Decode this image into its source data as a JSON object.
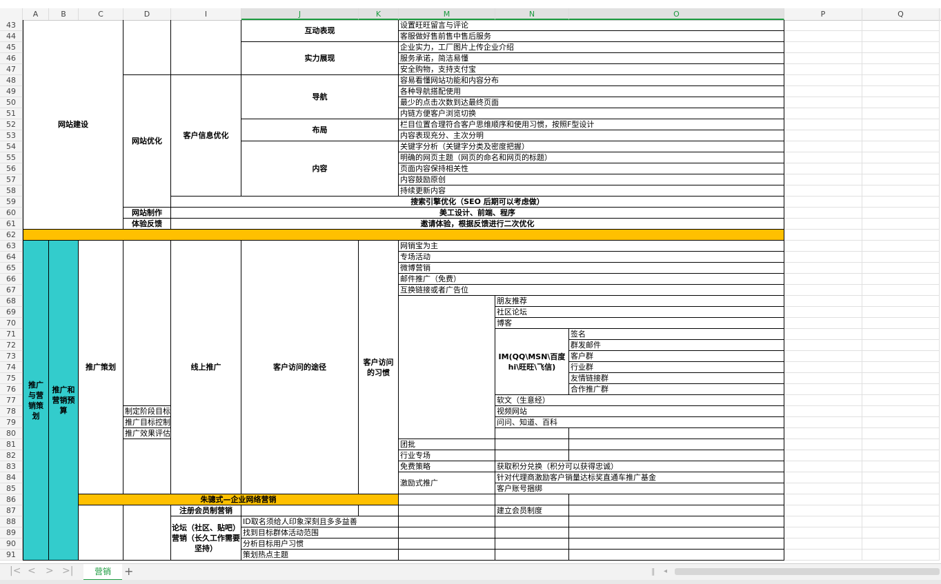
{
  "sheet": {
    "tab_label": "营销",
    "columns": [
      "A",
      "B",
      "C",
      "D",
      "I",
      "J",
      "K",
      "M",
      "N",
      "O",
      "P",
      "Q"
    ],
    "selected_columns": [
      "J",
      "K",
      "M",
      "N",
      "O"
    ],
    "rows": [
      "43",
      "44",
      "45",
      "46",
      "47",
      "48",
      "49",
      "50",
      "51",
      "52",
      "53",
      "54",
      "55",
      "56",
      "57",
      "58",
      "59",
      "60",
      "61",
      "62",
      "63",
      "64",
      "65",
      "66",
      "67",
      "68",
      "69",
      "70",
      "71",
      "72",
      "73",
      "74",
      "75",
      "76",
      "77",
      "78",
      "79",
      "80",
      "81",
      "82",
      "83",
      "84",
      "85",
      "86",
      "87",
      "88",
      "89",
      "90",
      "91"
    ]
  },
  "cells": {
    "site_build": "网站建设",
    "interaction": "互动表现",
    "r43m": "设置旺旺留言与评论",
    "r44m": "客服做好售前售中售后服务",
    "strength": "实力展现",
    "r45m": "企业实力，工厂图片上传企业介绍",
    "r46m": "服务承诺，简洁易懂",
    "r47m": "安全购物，支持支付宝",
    "site_opt": "网站优化",
    "cust_info_opt": "客户信息优化",
    "nav": "导航",
    "r48m": "容易看懂网站功能和内容分布",
    "r49m": "各种导航搭配使用",
    "r50m": "最少的点击次数到达最终页面",
    "r51m": "内链方便客户浏览切换",
    "layout": "布局",
    "r52m": "栏目位置合理符合客户思维顺序和使用习惯，按照F型设计",
    "r53m": "内容表现充分、主次分明",
    "content": "内容",
    "r54m": "关键字分析（关键字分类及密度把握）",
    "r55m": "明确的网页主题（网页的命名和网页的标题）",
    "r56m": "页面内容保持相关性",
    "r57m": "内容鼓励原创",
    "r58m": "持续更新内容",
    "r59": "搜索引擎优化（SEO 后期可以考虑做）",
    "site_make": "网站制作",
    "r60": "美工设计、前端、程序",
    "feedback": "体验反馈",
    "r61": "邀请体验，根据反馈进行二次优化",
    "promo_sales_plan": "推广与营销策划",
    "promo_budget": "推广和营销预算",
    "promo_plan": "推广策划",
    "d78": "制定阶段目标",
    "d79": "推广目标控制",
    "d80": "推广效果评估",
    "online_promo": "线上推广",
    "visit_path": "客户访问的途径",
    "visit_habit": "客户访问的习惯",
    "r63m": "网销宝为主",
    "r64m": "专场活动",
    "r65m": "微博营销",
    "r66m": "邮件推广（免费）",
    "r67m": "互换链接或者广告位",
    "r68n": "朋友推荐",
    "r69n": "社区论坛",
    "r70n": "博客",
    "im": "IM(QQ\\MSN\\百度hi\\旺旺\\飞信)",
    "r71o": "签名",
    "r72o": "群发邮件",
    "r73o": "客户群",
    "r74o": "行业群",
    "r75o": "友情链接群",
    "r76o": "合作推广群",
    "r77n": "软文（生意经）",
    "r78n": "视频网站",
    "r79n": "问问、知道、百科",
    "r81m": "团批",
    "r82m": "行业专场",
    "r83m": "免费策略",
    "r83n": "获取积分兑换（积分可以获得忠诚）",
    "incentive": "激励式推广",
    "r84n": "针对代理商激励客户销量达标奖直通车推广基金",
    "r85n": "客户账号捆绑",
    "banner86": "朱骢式—企业网络营销",
    "r87i": "注册会员制营销",
    "r87n": "建立会员制度",
    "forum": "论坛（社区、贴吧）营销（长久工作需要坚持）",
    "r88j": "ID取名须给人印象深刻且多多益善",
    "r89j": "找到目标群体活动范围",
    "r90j": "分析目标用户习惯",
    "r91j": "策划热点主题"
  }
}
